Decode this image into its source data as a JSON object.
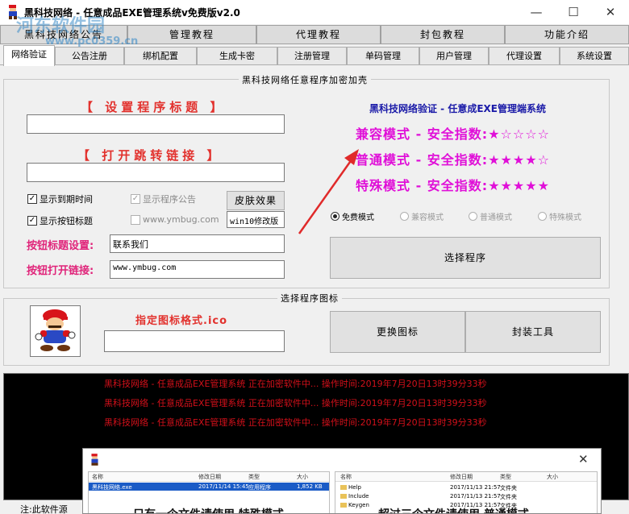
{
  "window": {
    "title": "黑科技网络 - 任意成品EXE管理系统v免费版v2.0",
    "watermark": "河东软件园",
    "watermark_url": "www.pc0359.cn",
    "minimize": "—",
    "maximize": "☐",
    "close": "✕"
  },
  "top_tabs": [
    "黑科技网络公告",
    "管理教程",
    "代理教程",
    "封包教程",
    "功能介绍"
  ],
  "sub_tabs": [
    "网络验证",
    "公告注册",
    "绑机配置",
    "生成卡密",
    "注册管理",
    "单码管理",
    "用户管理",
    "代理设置",
    "系统设置"
  ],
  "encrypt_group": {
    "title": "黑科技网络任意程序加密加壳",
    "title_heading": "【 设置程序标题 】",
    "title_value": "",
    "link_heading": "【 打开跳转链接 】",
    "link_value": "",
    "checkboxes": {
      "show_expiry": {
        "label": "显示到期时间",
        "checked": true
      },
      "show_notice": {
        "label": "显示程序公告",
        "checked": true
      },
      "show_button_title": {
        "label": "显示按钮标题",
        "checked": true
      },
      "website": {
        "label": "www.ymbug.com",
        "checked": false
      }
    },
    "skin_button": "皮肤效果",
    "skin_value": "win10修改版",
    "button_title_label": "按钮标题设置:",
    "button_title_value": "联系我们",
    "button_link_label": "按钮打开链接:",
    "button_link_value": "www.ymbug.com",
    "brand": "黑科技网络验证 - 任意成EXE管理端系统",
    "modes": [
      {
        "name": "兼容模式",
        "index_label": "安全指数:",
        "stars": "★☆☆☆☆",
        "rating": 1
      },
      {
        "name": "普通模式",
        "index_label": "安全指数:",
        "stars": "★★★★☆",
        "rating": 4
      },
      {
        "name": "特殊模式",
        "index_label": "安全指数:",
        "stars": "★★★★★",
        "rating": 5
      }
    ],
    "radios": [
      {
        "label": "免费模式",
        "selected": true
      },
      {
        "label": "兼容模式",
        "selected": false
      },
      {
        "label": "普通模式",
        "selected": false
      },
      {
        "label": "特殊模式",
        "selected": false
      }
    ],
    "select_button": "选择程序"
  },
  "icon_group": {
    "title": "选择程序图标",
    "hint": "指定图标格式.ico",
    "path_value": "",
    "change_button": "更换图标",
    "pack_button": "封装工具"
  },
  "log_lines": [
    "黑科技网络 - 任意成品EXE管理系统 正在加密软件中...   操作时间:2019年7月20日13时39分33秒",
    "黑科技网络 - 任意成品EXE管理系统 正在加密软件中...   操作时间:2019年7月20日13时39分33秒",
    "黑科技网络 - 任意成品EXE管理系统 正在加密软件中...   操作时间:2019年7月20日13时39分33秒"
  ],
  "overlay": {
    "close": "✕",
    "left_headers": [
      "名称",
      "修改日期",
      "类型",
      "大小"
    ],
    "left_row": {
      "name": "黑科技网络.exe",
      "date": "2017/11/14 15:45",
      "type": "应用程序",
      "size": "1,852 KB"
    },
    "right_headers": [
      "名称",
      "修改日期",
      "类型",
      "大小"
    ],
    "right_rows": [
      {
        "name": "Help",
        "date": "2017/11/13 21:57",
        "type": "文件夹"
      },
      {
        "name": "Include",
        "date": "2017/11/13 21:57",
        "type": "文件夹"
      },
      {
        "name": "Keygen",
        "date": "2017/11/13 21:57",
        "type": "文件夹"
      }
    ],
    "caption_left": "只有一个文件请使用 特殊模式",
    "caption_right": "超过三个文件请使用 普通模式"
  },
  "status_text": "注:此软件源"
}
